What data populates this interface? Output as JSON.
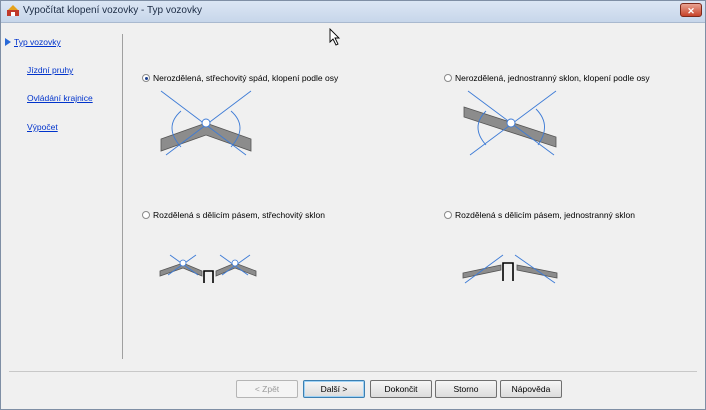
{
  "window": {
    "title": "Vypočítat klopení vozovky - Typ vozovky",
    "close_label": "✕"
  },
  "sidebar": {
    "items": [
      {
        "label": "Typ vozovky",
        "active": true
      },
      {
        "label": "Jízdní pruhy",
        "active": false
      },
      {
        "label": "Ovládání krajnice",
        "active": false
      },
      {
        "label": "Výpočet",
        "active": false
      }
    ]
  },
  "options": [
    {
      "label": "Nerozdělená, střechovitý spád, klopení podle osy",
      "selected": true
    },
    {
      "label": "Nerozdělená, jednostranný sklon, klopení podle osy",
      "selected": false
    },
    {
      "label": "Rozdělená s dělicím pásem, střechovitý sklon",
      "selected": false
    },
    {
      "label": "Rozdělená s dělicím pásem, jednostranný sklon",
      "selected": false
    }
  ],
  "buttons": {
    "back": "< Zpět",
    "next": "Další >",
    "finish": "Dokončit",
    "cancel": "Storno",
    "help": "Nápověda"
  },
  "colors": {
    "road_fill": "#8c8c8c",
    "axis_line": "#3d7bd6",
    "accent_link": "#0033cc"
  }
}
